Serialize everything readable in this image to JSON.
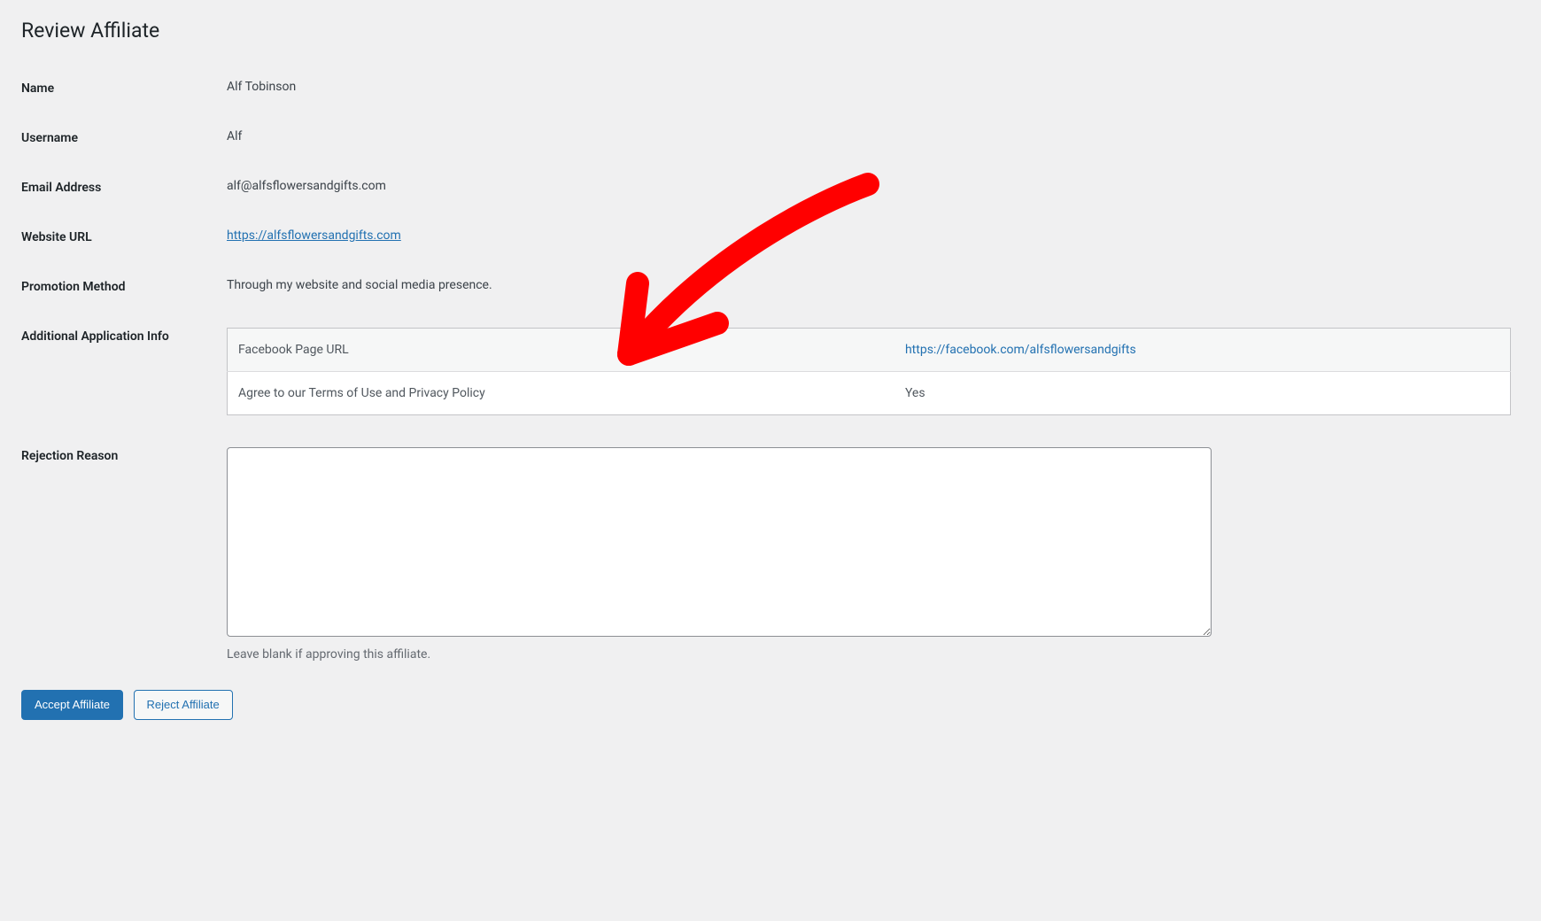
{
  "page": {
    "title": "Review Affiliate"
  },
  "labels": {
    "name": "Name",
    "username": "Username",
    "email": "Email Address",
    "website": "Website URL",
    "promotion": "Promotion Method",
    "additional": "Additional Application Info",
    "rejection": "Rejection Reason"
  },
  "affiliate": {
    "name": "Alf Tobinson",
    "username": "Alf",
    "email": "alf@alfsflowersandgifts.com",
    "website_url": "https://alfsflowersandgifts.com",
    "promotion_method": "Through my website and social media presence."
  },
  "additional_info": [
    {
      "label": "Facebook Page URL",
      "value": "https://facebook.com/alfsflowersandgifts",
      "is_link": true
    },
    {
      "label": "Agree to our Terms of Use and Privacy Policy",
      "value": "Yes",
      "is_link": false
    }
  ],
  "rejection": {
    "value": "",
    "hint": "Leave blank if approving this affiliate."
  },
  "buttons": {
    "accept": "Accept Affiliate",
    "reject": "Reject Affiliate"
  },
  "annotation": {
    "type": "arrow",
    "color": "#ff0000",
    "points_to": "additional-info-table"
  }
}
